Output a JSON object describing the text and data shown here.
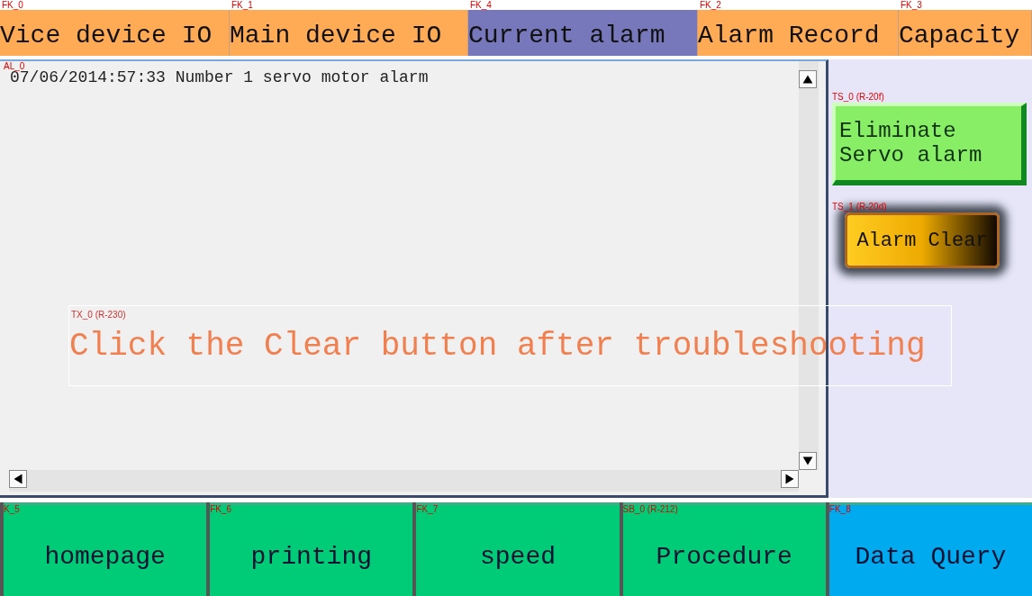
{
  "tabs": [
    {
      "tag": "FK_0",
      "label": "Vice device IO",
      "selected": false
    },
    {
      "tag": "FK_1",
      "label": "Main device IO",
      "selected": false
    },
    {
      "tag": "FK_4",
      "label": "Current alarm",
      "selected": true
    },
    {
      "tag": "FK_2",
      "label": "Alarm Record",
      "selected": false
    },
    {
      "tag": "FK_3",
      "label": "Capacity",
      "selected": false
    }
  ],
  "alarm_list": {
    "tag": "AL_0",
    "rows": [
      {
        "text": "07/06/2014:57:33 Number 1 servo motor alarm"
      }
    ]
  },
  "side_buttons": [
    {
      "kind": "flat",
      "tag": "TS_0 (R-20f)",
      "label": "Eliminate Servo alarm"
    },
    {
      "kind": "glossy",
      "tag": "TS_1 (R-20d)",
      "label": "Alarm Clear"
    }
  ],
  "hint": {
    "tag": "TX_0 (R-230)",
    "text": "Click the Clear button after troubleshooting"
  },
  "nav_buttons": [
    {
      "tag": "K_5",
      "label": "homepage",
      "color": "#00cc77"
    },
    {
      "tag": "FK_6",
      "label": "printing",
      "color": "#00cc77"
    },
    {
      "tag": "FK_7",
      "label": "speed",
      "color": "#00cc77"
    },
    {
      "tag": "SB_0 (R-212)",
      "label": "Procedure",
      "color": "#00cc77"
    },
    {
      "tag": "FK_8",
      "label": "Data Query",
      "color": "#00aaee"
    }
  ]
}
